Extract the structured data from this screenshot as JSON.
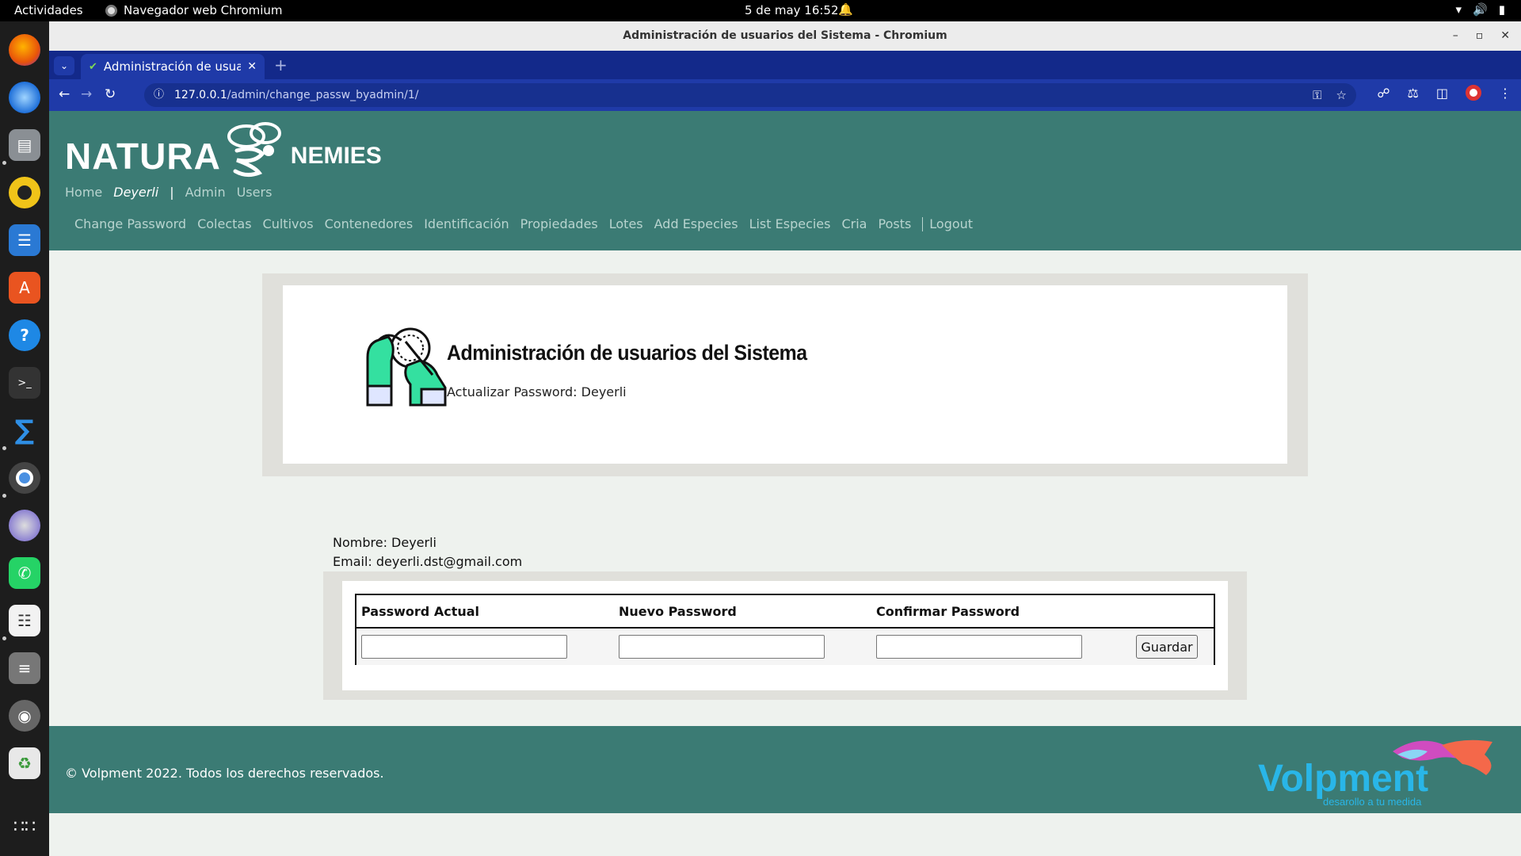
{
  "system": {
    "activities": "Actividades",
    "app_name": "Navegador web Chromium",
    "clock": "5 de may  16:52"
  },
  "window": {
    "title": "Administración de usuarios del Sistema - Chromium"
  },
  "browser": {
    "tab_title": "Administración de usuari",
    "url_host": "127.0.0.1",
    "url_path": "/admin/change_passw_byadmin/1/"
  },
  "site": {
    "logo_part1": "Natura",
    "logo_part2": "nemies",
    "nav": {
      "home": "Home",
      "user": "Deyerli",
      "separator": "|",
      "admin": "Admin",
      "users": "Users"
    },
    "subnav": [
      "Change Password",
      "Colectas",
      "Cultivos",
      "Contenedores",
      "Identificación",
      "Propiedades",
      "Lotes",
      "Add Especies",
      "List Especies",
      "Cria",
      "Posts"
    ],
    "logout": "Logout"
  },
  "hero": {
    "title": "Administración de usuarios del Sistema",
    "subtitle": "Actualizar Password: Deyerli"
  },
  "user": {
    "name_line": "Nombre: Deyerli",
    "email_line": "Email: deyerli.dst@gmail.com"
  },
  "form": {
    "col_current": "Password Actual",
    "col_new": "Nuevo Password",
    "col_confirm": "Confirmar Password",
    "save_label": "Guardar"
  },
  "footer": {
    "copyright": "© Volpment 2022. Todos los derechos reservados.",
    "brand": "Volpment",
    "tagline": "desarollo a tu medida"
  },
  "colors": {
    "header_bg": "#3b7b74",
    "chrome_blue": "#1f3aa8",
    "brand_cyan": "#29b6e8"
  }
}
